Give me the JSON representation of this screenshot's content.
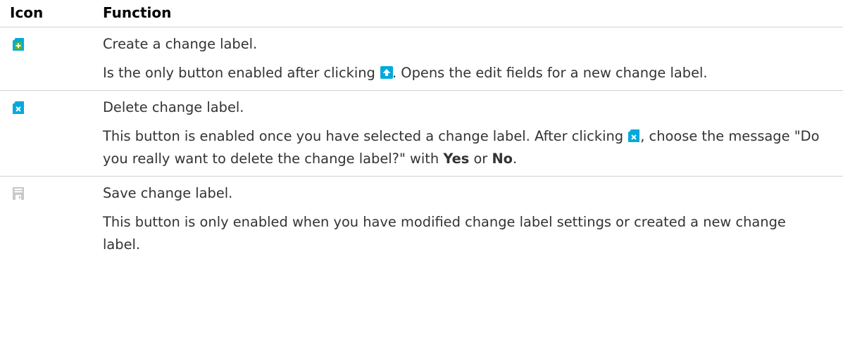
{
  "header": {
    "icon_col": "Icon",
    "function_col": "Function"
  },
  "rows": [
    {
      "icon": "new-change-label-icon",
      "title": "Create a change label.",
      "desc_before": "Is the only button enabled after clicking ",
      "desc_inline_icon": "upload-icon",
      "desc_after": ". Opens the edit fields for a new change label."
    },
    {
      "icon": "delete-change-label-icon",
      "title": "Delete change label.",
      "desc_part1": "This button is enabled once you have selected a change label. After clicking ",
      "desc_inline_icon": "delete-change-label-icon",
      "desc_part2": ", choose the message \"Do you really want to delete the change label?\" with ",
      "yes": "Yes",
      "desc_part3": " or ",
      "no": "No",
      "desc_part4": "."
    },
    {
      "icon": "save-icon",
      "title": "Save change label.",
      "desc": "This button is only enabled when you have modified change label settings or created a new change label."
    }
  ],
  "colors": {
    "text": "#333333",
    "heading": "#000000",
    "icon_accent": "#02aadc",
    "icon_green": "#56b42d",
    "icon_disabled": "#c8c8c8",
    "rule": "#d2d2d2"
  }
}
